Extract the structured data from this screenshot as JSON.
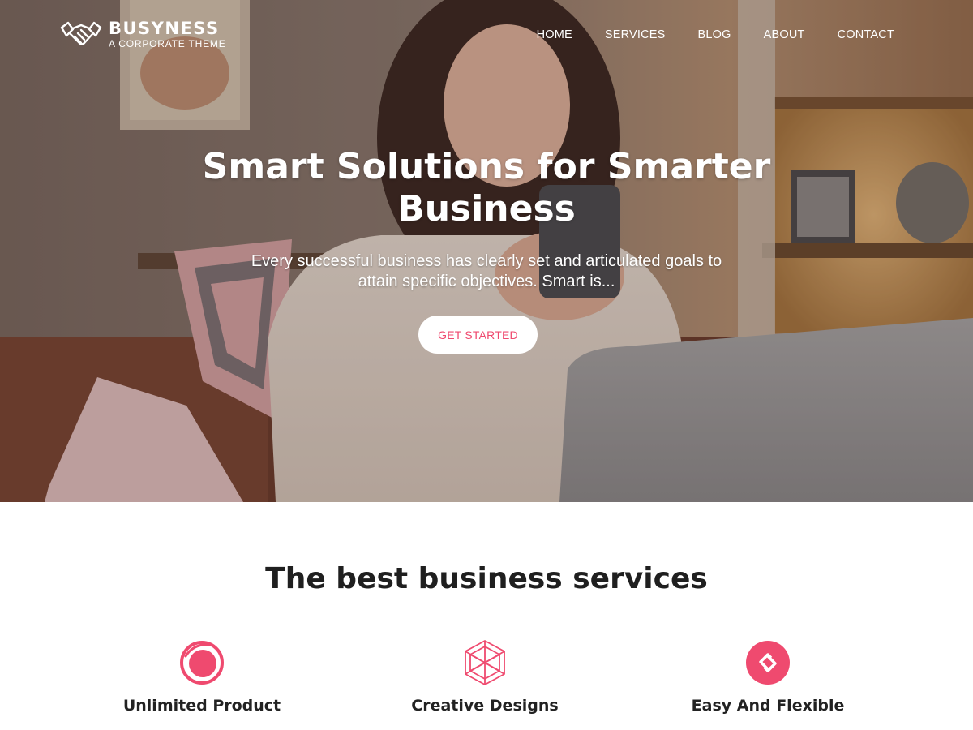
{
  "brand": {
    "name": "BUSYNESS",
    "tagline": "A CORPORATE THEME",
    "logo_icon": "handshake-icon"
  },
  "nav": {
    "items": [
      {
        "label": "HOME"
      },
      {
        "label": "SERVICES"
      },
      {
        "label": "BLOG"
      },
      {
        "label": "ABOUT"
      },
      {
        "label": "CONTACT"
      }
    ]
  },
  "hero": {
    "title": "Smart Solutions for Smarter Business",
    "text": "Every successful business has clearly set and articulated goals to attain specific objectives. Smart is...",
    "cta_label": "GET STARTED"
  },
  "services": {
    "title": "The best business services",
    "items": [
      {
        "label": "Unlimited Product",
        "icon": "ring-circle-icon"
      },
      {
        "label": "Creative Designs",
        "icon": "geometric-hexagon-icon"
      },
      {
        "label": "Easy And Flexible",
        "icon": "linked-diamonds-icon"
      }
    ]
  },
  "colors": {
    "accent": "#ef4a6f",
    "text_dark": "#222222",
    "white": "#ffffff"
  }
}
